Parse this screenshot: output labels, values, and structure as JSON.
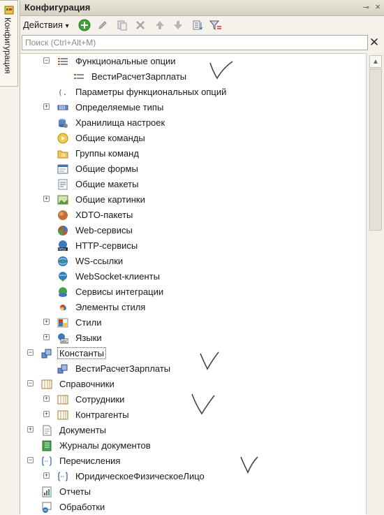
{
  "side_tab": {
    "label": "Конфигурация"
  },
  "panel": {
    "title": "Конфигурация"
  },
  "toolbar": {
    "actions_label": "Действия",
    "actions_arrow": "▾"
  },
  "search": {
    "placeholder": "Поиск (Ctrl+Alt+M)"
  },
  "tree": [
    {
      "label": "Функциональные опции",
      "icon": "functional-options-icon",
      "expander": "−",
      "level": 2
    },
    {
      "label": "ВестиРасчетЗарплаты",
      "icon": "functional-option-icon",
      "expander": "",
      "level": 3
    },
    {
      "label": "Параметры функциональных опций",
      "icon": "functional-option-params-icon",
      "expander": "",
      "level": 2
    },
    {
      "label": "Определяемые типы",
      "icon": "defined-types-icon",
      "expander": "+",
      "level": 2
    },
    {
      "label": "Хранилища настроек",
      "icon": "settings-storage-icon",
      "expander": "",
      "level": 2
    },
    {
      "label": "Общие команды",
      "icon": "common-commands-icon",
      "expander": "",
      "level": 2
    },
    {
      "label": "Группы команд",
      "icon": "command-groups-icon",
      "expander": "",
      "level": 2
    },
    {
      "label": "Общие формы",
      "icon": "common-forms-icon",
      "expander": "",
      "level": 2
    },
    {
      "label": "Общие макеты",
      "icon": "common-templates-icon",
      "expander": "",
      "level": 2
    },
    {
      "label": "Общие картинки",
      "icon": "common-pictures-icon",
      "expander": "+",
      "level": 2
    },
    {
      "label": "XDTO-пакеты",
      "icon": "xdto-packages-icon",
      "expander": "",
      "level": 2
    },
    {
      "label": "Web-сервисы",
      "icon": "web-services-icon",
      "expander": "",
      "level": 2
    },
    {
      "label": "HTTP-сервисы",
      "icon": "http-services-icon",
      "expander": "",
      "level": 2
    },
    {
      "label": "WS-ссылки",
      "icon": "ws-references-icon",
      "expander": "",
      "level": 2
    },
    {
      "label": "WebSocket-клиенты",
      "icon": "websocket-clients-icon",
      "expander": "",
      "level": 2
    },
    {
      "label": "Сервисы интеграции",
      "icon": "integration-services-icon",
      "expander": "",
      "level": 2
    },
    {
      "label": "Элементы стиля",
      "icon": "style-items-icon",
      "expander": "",
      "level": 2
    },
    {
      "label": "Стили",
      "icon": "styles-icon",
      "expander": "+",
      "level": 2
    },
    {
      "label": "Языки",
      "icon": "languages-icon",
      "expander": "+",
      "level": 2
    },
    {
      "label": "Константы",
      "icon": "constants-icon",
      "expander": "−",
      "level": 1
    },
    {
      "label": "ВестиРасчетЗарплаты",
      "icon": "constant-icon",
      "expander": "",
      "level": 2
    },
    {
      "label": "Справочники",
      "icon": "catalogs-icon",
      "expander": "−",
      "level": 1
    },
    {
      "label": "Сотрудники",
      "icon": "catalog-icon",
      "expander": "+",
      "level": 2
    },
    {
      "label": "Контрагенты",
      "icon": "catalog-icon",
      "expander": "+",
      "level": 2
    },
    {
      "label": "Документы",
      "icon": "documents-icon",
      "expander": "+",
      "level": 1
    },
    {
      "label": "Журналы документов",
      "icon": "document-journals-icon",
      "expander": "",
      "level": 1
    },
    {
      "label": "Перечисления",
      "icon": "enums-icon",
      "expander": "−",
      "level": 1
    },
    {
      "label": "ЮридическоеФизическоеЛицо",
      "icon": "enum-icon",
      "expander": "+",
      "level": 2
    },
    {
      "label": "Отчеты",
      "icon": "reports-icon",
      "expander": "",
      "level": 1
    },
    {
      "label": "Обработки",
      "icon": "data-processors-icon",
      "expander": "",
      "level": 1
    }
  ],
  "selected_index": 19
}
